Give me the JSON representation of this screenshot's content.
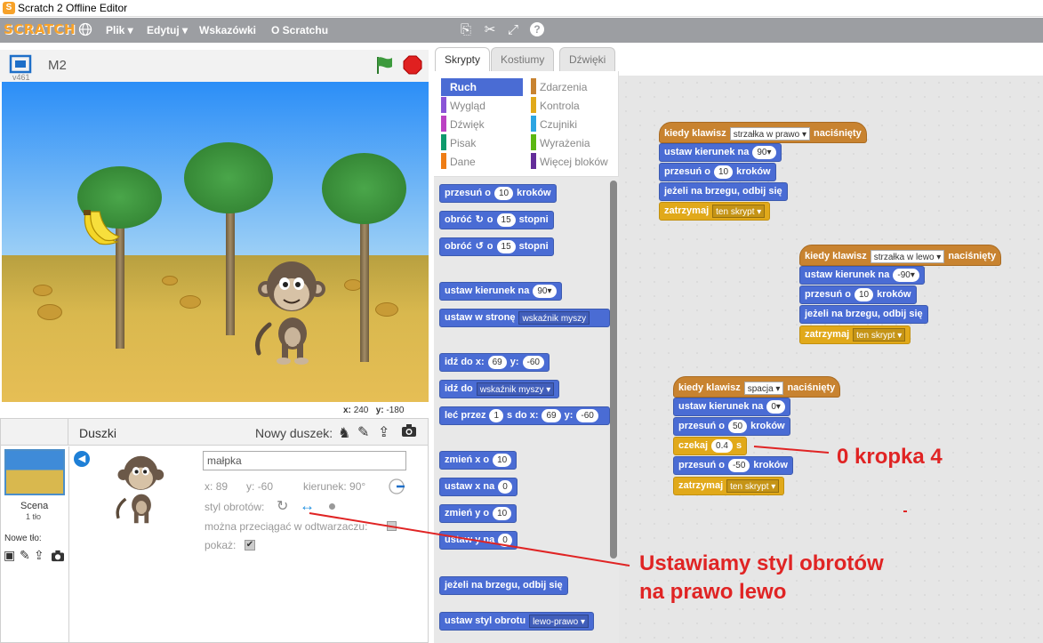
{
  "window": {
    "title": "Scratch 2 Offline Editor"
  },
  "menubar": {
    "logo": "SCRATCH",
    "items": [
      "Plik ▾",
      "Edytuj ▾",
      "Wskazówki",
      "O Scratchu"
    ]
  },
  "stage": {
    "sprite_name": "M2",
    "version": "v461",
    "coords": {
      "x_label": "x:",
      "x": "240",
      "y_label": "y:",
      "y": "-180"
    }
  },
  "tabs": [
    "Skrypty",
    "Kostiumy",
    "Dźwięki"
  ],
  "categories": {
    "left": [
      {
        "label": "Ruch",
        "color": "#4a6cd4"
      },
      {
        "label": "Wygląd",
        "color": "#8a55d7"
      },
      {
        "label": "Dźwięk",
        "color": "#bb42c3"
      },
      {
        "label": "Pisak",
        "color": "#0e9a6c"
      },
      {
        "label": "Dane",
        "color": "#ee7d16"
      }
    ],
    "right": [
      {
        "label": "Zdarzenia",
        "color": "#c88330"
      },
      {
        "label": "Kontrola",
        "color": "#e1a91a"
      },
      {
        "label": "Czujniki",
        "color": "#2ca5e2"
      },
      {
        "label": "Wyrażenia",
        "color": "#5cb712"
      },
      {
        "label": "Więcej bloków",
        "color": "#632d99"
      }
    ]
  },
  "palette": {
    "move": {
      "a": "przesuń o",
      "v": "10",
      "b": "kroków"
    },
    "turn_right": {
      "a": "obróć",
      "v": "15",
      "b": "stopni"
    },
    "turn_left": {
      "a": "obróć",
      "v": "15",
      "b": "stopni"
    },
    "point_dir": {
      "a": "ustaw kierunek na",
      "v": "90▾"
    },
    "point_towards": {
      "a": "ustaw w stronę",
      "v": "wskaźnik myszy"
    },
    "goto_xy": {
      "a": "idź do x:",
      "x": "69",
      "b": "y:",
      "y": "-60"
    },
    "goto": {
      "a": "idź do",
      "v": "wskaźnik myszy ▾"
    },
    "glide": {
      "a": "leć przez",
      "s": "1",
      "b": "s do x:",
      "x": "69",
      "c": "y:",
      "y": "-60"
    },
    "change_x": {
      "a": "zmień x o",
      "v": "10"
    },
    "set_x": {
      "a": "ustaw x na",
      "v": "0"
    },
    "change_y": {
      "a": "zmień y o",
      "v": "10"
    },
    "set_y": {
      "a": "ustaw y na",
      "v": "0"
    },
    "bounce": {
      "a": "jeżeli na brzegu, odbij się"
    },
    "rotation": {
      "a": "ustaw styl obrotu",
      "v": "lewo-prawo ▾"
    }
  },
  "scripts": {
    "s1": {
      "hat": {
        "a": "kiedy klawisz",
        "v": "strzałka w prawo ▾",
        "b": "naciśnięty"
      },
      "b1": {
        "a": "ustaw kierunek na",
        "v": "90▾"
      },
      "b2": {
        "a": "przesuń o",
        "v": "10",
        "b": "kroków"
      },
      "b3": {
        "a": "jeżeli na brzegu, odbij się"
      },
      "b4": {
        "a": "zatrzymaj",
        "v": "ten skrypt ▾"
      }
    },
    "s2": {
      "hat": {
        "a": "kiedy klawisz",
        "v": "strzałka w lewo ▾",
        "b": "naciśnięty"
      },
      "b1": {
        "a": "ustaw kierunek na",
        "v": "-90▾"
      },
      "b2": {
        "a": "przesuń o",
        "v": "10",
        "b": "kroków"
      },
      "b3": {
        "a": "jeżeli na brzegu, odbij się"
      },
      "b4": {
        "a": "zatrzymaj",
        "v": "ten skrypt ▾"
      }
    },
    "s3": {
      "hat": {
        "a": "kiedy klawisz",
        "v": "spacja ▾",
        "b": "naciśnięty"
      },
      "b1": {
        "a": "ustaw kierunek na",
        "v": "0▾"
      },
      "b2": {
        "a": "przesuń o",
        "v": "50",
        "b": "kroków"
      },
      "b3": {
        "a": "czekaj",
        "v": "0.4",
        "b": "s"
      },
      "b4": {
        "a": "przesuń o",
        "v": "-50",
        "b": "kroków"
      },
      "b5": {
        "a": "zatrzymaj",
        "v": "ten skrypt ▾"
      }
    }
  },
  "annotations": {
    "wait": "0 kropka 4",
    "style_line1": "Ustawiamy styl obrotów",
    "style_line2": "na prawo lewo",
    "color": "#e02424"
  },
  "sprites_panel": {
    "title": "Duszki",
    "new_sprite": "Nowy duszek:",
    "scene_label": "Scena",
    "scene_sub": "1 tło",
    "new_backdrop": "Nowe tło:",
    "name_value": "małpka",
    "x_label": "x:",
    "x": "89",
    "y_label": "y:",
    "y": "-60",
    "dir_label": "kierunek:",
    "dir": "90°",
    "rotation_style": "styl obrotów:",
    "draggable": "można przeciągać w odtwarzaczu:",
    "show": "pokaż:"
  }
}
